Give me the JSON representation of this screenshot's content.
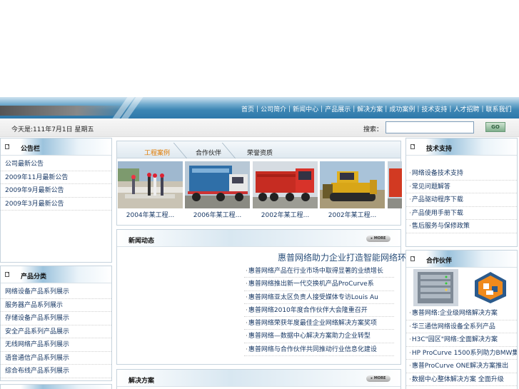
{
  "nav": {
    "items": [
      "首页",
      "公司简介",
      "新闻中心",
      "产品展示",
      "解决方案",
      "成功案例",
      "技术支持",
      "人才招聘",
      "联系我们"
    ]
  },
  "infobar": {
    "date": "今天是:111年7月1日 星期五",
    "search_label": "搜索：",
    "search_value": "",
    "go_label": "GO"
  },
  "left_box1": {
    "title": "公告栏",
    "items": [
      "公司最新公告",
      "2009年11月最新公告",
      "2009年9月最新公告",
      "2009年3月最新公告"
    ]
  },
  "left_box2": {
    "title": "产品分类",
    "items": [
      "网络设备产品系列展示",
      "服务器产品系列展示",
      "存储设备产品系列展示",
      "安全产品系列产品展示",
      "无线网络产品系列展示",
      "语音通信产品系列展示",
      "综合布线产品系列展示"
    ]
  },
  "tabs": {
    "items": [
      "工程案例",
      "合作伙伴",
      "荣誉资质"
    ],
    "active_index": 0
  },
  "photos": {
    "captions": [
      "2004年某工程...",
      "2006年某工程...",
      "2002年某工程...",
      "2002年某工程..."
    ]
  },
  "news": {
    "title": "新闻动态",
    "more_label": "MORE",
    "headline": "惠普网络助力企业打造智能网络环境...",
    "items": [
      "惠普网络产品在行业市场中取得显著的业绩增长",
      "惠普网络推出新一代交换机产品ProCurve系",
      "惠普网络亚太区负责人接受媒体专访Louis Au",
      "惠普网络2010年度合作伙伴大会隆重召开",
      "惠普网络荣获年度最佳企业网络解决方案奖项",
      "惠普网络—数据中心解决方案助力企业转型",
      "惠普网络与合作伙伴共同推动行业信息化建设"
    ]
  },
  "box2": {
    "title": "解决方案",
    "more_label": "MORE"
  },
  "right_box1": {
    "title": "技术支持",
    "items": [
      "网络设备技术支持",
      "常见问题解答",
      "产品驱动程序下载",
      "产品使用手册下载",
      "售后服务与保修政策"
    ]
  },
  "right_box2": {
    "title": "合作伙伴",
    "items": [
      "惠普网络:企业级网络解决方案",
      "华三通信网络设备全系列产品",
      "H3C\"园区\"网络:全面解决方案",
      "HP ProCurve 1500系列助力BMW集",
      "惠普ProCurve ONE解决方案推出",
      "数据中心整体解决方案 全面升级"
    ]
  }
}
